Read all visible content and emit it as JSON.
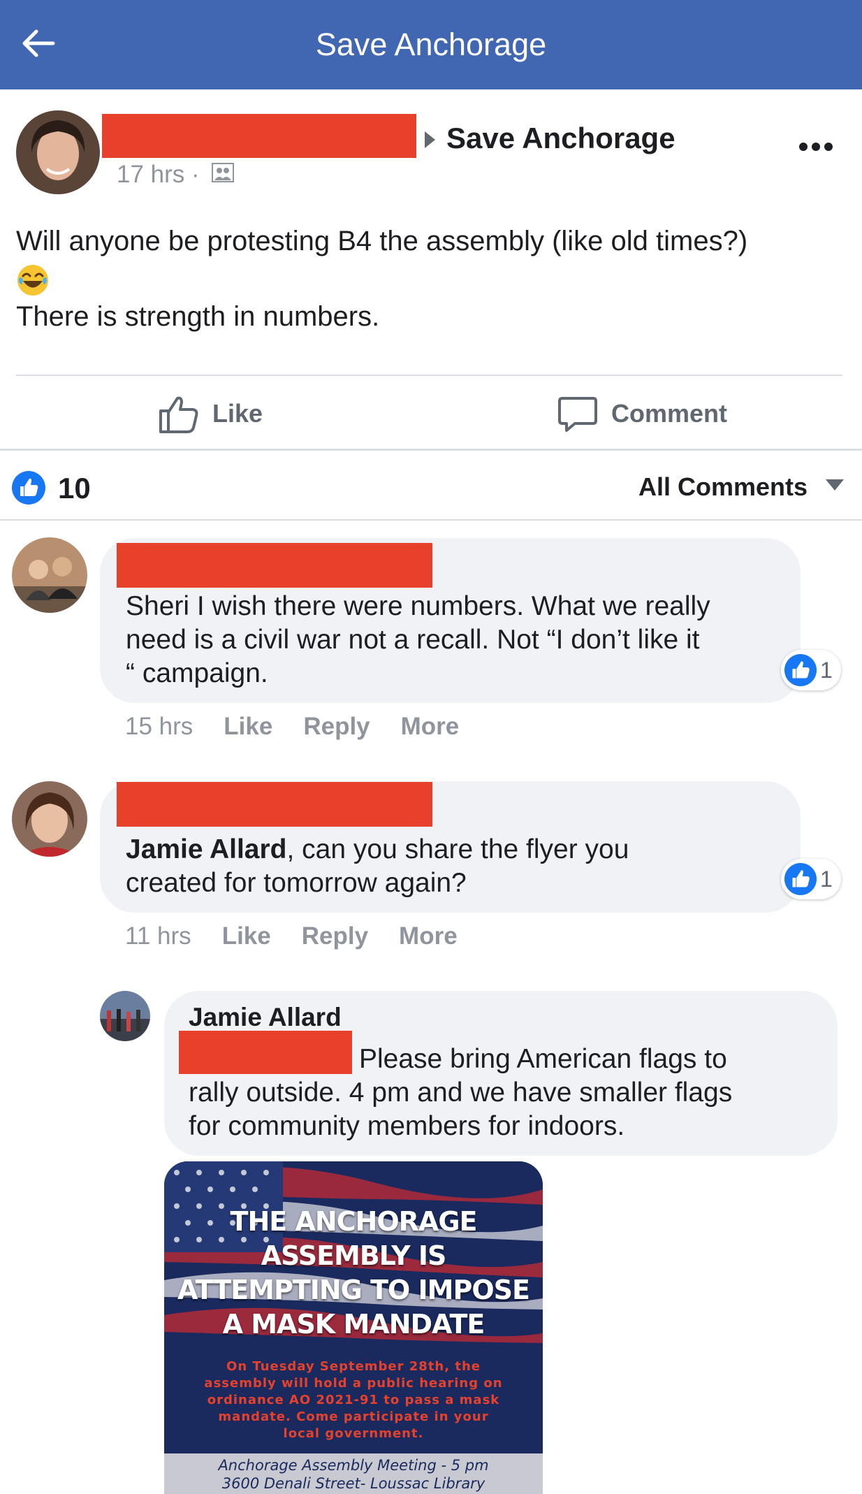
{
  "header": {
    "title": "Save Anchorage",
    "back_icon": "back-arrow-icon"
  },
  "post": {
    "group_name": "Save Anchorage",
    "time": "17 hrs ·",
    "text_line1": "Will anyone be protesting B4 the assembly (like old times?)",
    "emoji": "laughing-crying-emoji",
    "text_line2": "There is strength in numbers.",
    "like_label": "Like",
    "comment_label": "Comment",
    "like_count": "10",
    "sort_label": "All Comments"
  },
  "comments": [
    {
      "text": "Sheri I wish there were numbers. What we really need is a civil war not a recall. Not “I don’t like it ” campaign.",
      "text_lines": [
        "Sheri I wish there were numbers. What we really",
        "need is a civil war not a recall. Not “I don’t like it",
        "“ campaign."
      ],
      "reaction_count": "1",
      "time": "15 hrs",
      "like": "Like",
      "reply": "Reply",
      "more": "More"
    },
    {
      "mention": "Jamie Allard",
      "text_rest": ", can you share the flyer you",
      "text_line2": "created for tomorrow again?",
      "reaction_count": "1",
      "time": "11 hrs",
      "like": "Like",
      "reply": "Reply",
      "more": "More"
    }
  ],
  "reply": {
    "author": "Jamie Allard",
    "text_line1": "Please bring American flags to",
    "text_line2": "rally outside. 4 pm and we have smaller flags",
    "text_line3": "for community members for indoors."
  },
  "flyer": {
    "headline": [
      "THE ANCHORAGE",
      "ASSEMBLY IS",
      "ATTEMPTING TO IMPOSE",
      "A MASK MANDATE"
    ],
    "details": [
      "On Tuesday September 28th, the",
      "assembly will hold a public hearing on",
      "ordinance AO 2021-91 to pass a mask",
      "mandate. Come participate in your",
      "local government."
    ],
    "footer": [
      "Anchorage Assembly Meeting - 5 pm",
      "3600 Denali Street- Loussac Library"
    ]
  },
  "colors": {
    "header_bg": "#4267b2",
    "redaction": "#e8412b",
    "bubble_bg": "#f0f2f5",
    "like_blue": "#1877f2"
  }
}
